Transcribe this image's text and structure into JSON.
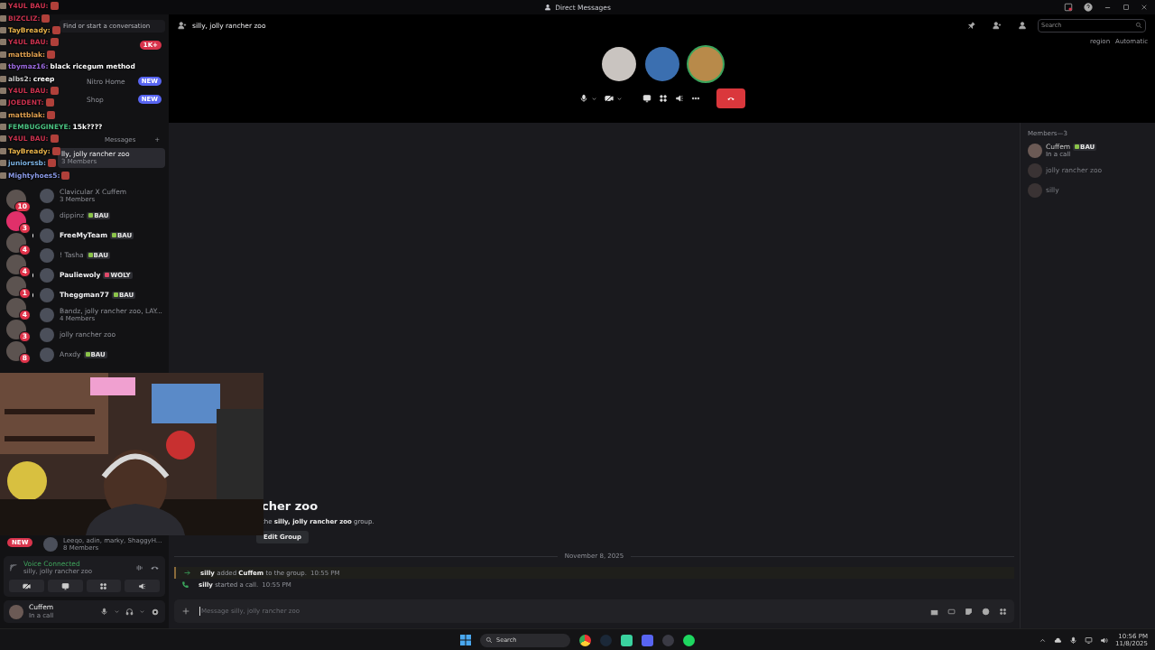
{
  "window": {
    "title": "Direct Messages"
  },
  "stream_chat": [
    {
      "user": "Y4UL BAU:",
      "color": "#c8324e",
      "emote": true
    },
    {
      "user": "BIZCLIZ:",
      "color": "#c8324e",
      "emote": true
    },
    {
      "user": "TayBready:",
      "color": "#e8b34a",
      "emote": true
    },
    {
      "user": "Y4UL BAU:",
      "color": "#c8324e",
      "emote": true
    },
    {
      "user": "mattblak:",
      "color": "#e0a050",
      "emote": true
    },
    {
      "user": "tbymaz16:",
      "color": "#9b6ae0",
      "message": "black ricegum method",
      "emote": false
    },
    {
      "user": "albs2:",
      "color": "#c8c8c8",
      "message": "creep",
      "emote": false
    },
    {
      "user": "Y4UL BAU:",
      "color": "#c8324e",
      "emote": true
    },
    {
      "user": "JOEDENT:",
      "color": "#c8324e",
      "emote": true
    },
    {
      "user": "mattblak:",
      "color": "#e0a050",
      "emote": true
    },
    {
      "user": "FEMBUGGINEYE:",
      "color": "#4ac080",
      "message": "15k????",
      "emote": false
    },
    {
      "user": "Y4UL BAU:",
      "color": "#c8324e",
      "emote": true
    },
    {
      "user": "TayBready:",
      "color": "#e8b34a",
      "emote": true
    },
    {
      "user": "juniorssb:",
      "color": "#7ab0e0",
      "emote": true
    },
    {
      "user": "Mightyhoes5:",
      "color": "#8a9ae8",
      "emote": true
    }
  ],
  "sidebar": {
    "search": {
      "placeholder": "Find or start a conversation"
    },
    "friends_badge": "1K+",
    "nav": [
      {
        "label": "Nitro Home",
        "badge": "NEW"
      },
      {
        "label": "Shop",
        "badge": "NEW"
      }
    ],
    "dm_header": "Messages",
    "add": "+",
    "dms": [
      {
        "name": "lly, jolly rancher zoo",
        "sub": "3 Members",
        "selected": true,
        "unread": false
      },
      {
        "name": "Clavicular X Cuffem",
        "sub": "3 Members",
        "selected": false,
        "unread": false
      },
      {
        "name": "dippinz",
        "tag": {
          "text": "BAU",
          "color": "#8bc34a"
        },
        "selected": false,
        "unread": false
      },
      {
        "name": "FreeMyTeam",
        "tag": {
          "text": "BAU",
          "color": "#8bc34a"
        },
        "selected": false,
        "unread": true
      },
      {
        "name": "! Tasha",
        "tag": {
          "text": "BAU",
          "color": "#8bc34a"
        },
        "selected": false,
        "unread": false
      },
      {
        "name": "Pauliewoly",
        "tag": {
          "text": "WOLY",
          "color": "#e04a6a"
        },
        "selected": false,
        "unread": true
      },
      {
        "name": "Theggman77",
        "tag": {
          "text": "BAU",
          "color": "#8bc34a"
        },
        "selected": false,
        "unread": true
      },
      {
        "name": "Bandz, jolly rancher zoo, LAY...",
        "sub": "4 Members",
        "selected": false,
        "unread": false
      },
      {
        "name": "jolly rancher zoo",
        "selected": false,
        "unread": false
      },
      {
        "name": "Anxdy",
        "tag": {
          "text": "BAU",
          "color": "#8bc34a"
        },
        "selected": false,
        "unread": false
      }
    ],
    "bottom_dm": {
      "name": "Leeqo, adin, marky, ShaggyH...",
      "sub": "8 Members",
      "badge": "NEW"
    }
  },
  "server_rail": [
    {
      "badge": "10"
    },
    {
      "badge": "3"
    },
    {
      "badge": "4"
    },
    {
      "badge": "4"
    },
    {
      "badge": "1"
    },
    {
      "badge": "4"
    },
    {
      "badge": "3"
    },
    {
      "badge": "8"
    }
  ],
  "voice": {
    "status": "Voice Connected",
    "channel": "silly, jolly rancher zoo"
  },
  "user": {
    "name": "Cuffem",
    "status": "In a call"
  },
  "header": {
    "title": "silly, jolly rancher zoo",
    "search": {
      "placeholder": "Search"
    }
  },
  "call": {
    "region_label": "region",
    "region": "Automatic"
  },
  "welcome": {
    "title": "cher zoo",
    "text": "the **silly, jolly rancher zoo** group.",
    "button": "Edit Group"
  },
  "messages": {
    "date": "November 8, 2025",
    "items": [
      {
        "kind": "join",
        "text": "**silly** added **Cuffem** to the group.",
        "time": "10:55 PM"
      },
      {
        "kind": "call",
        "text": "**silly** started a call.",
        "time": "10:55 PM"
      }
    ]
  },
  "composer": {
    "placeholder": "Message silly, jolly rancher zoo"
  },
  "members": {
    "title": "Members—3",
    "items": [
      {
        "name": "Cuffem",
        "tag": {
          "text": "BAU",
          "color": "#8bc34a"
        },
        "status": "In a call",
        "online": true
      },
      {
        "name": "jolly rancher zoo",
        "online": false
      },
      {
        "name": "silly",
        "online": false
      }
    ]
  },
  "taskbar": {
    "search": {
      "placeholder": "Search"
    },
    "time": "10:56 PM",
    "date": "11/8/2025"
  }
}
